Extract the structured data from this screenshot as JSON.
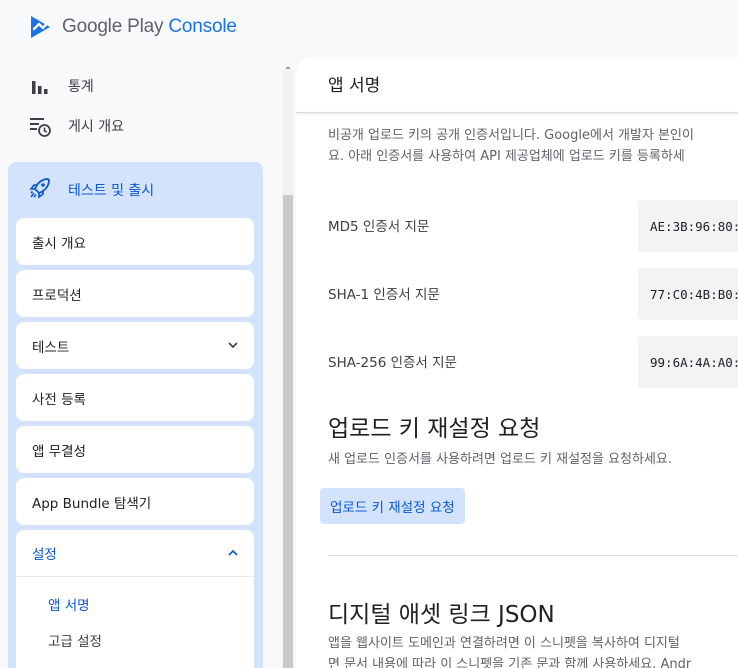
{
  "app": {
    "logo_google_play": "Google Play",
    "logo_console": "Console"
  },
  "nav": {
    "stats": "통계",
    "publishing_overview": "게시 개요",
    "section_label": "테스트 및 출시",
    "items": [
      {
        "label": "출시 개요"
      },
      {
        "label": "프로덕션"
      },
      {
        "label": "테스트"
      },
      {
        "label": "사전 등록"
      },
      {
        "label": "앱 무결성"
      },
      {
        "label": "App Bundle 탐색기"
      }
    ],
    "settings": {
      "label": "설정",
      "sub_items": [
        {
          "label": "앱 서명"
        },
        {
          "label": "고급 설정"
        }
      ]
    }
  },
  "main": {
    "panel_title": "앱 서명",
    "description_line1": "비공개 업로드 키의 공개 인증서입니다. Google에서 개발자 본인이",
    "description_line2": "요. 아래 인증서를 사용하여 API 제공업체에 업로드 키를 등록하세",
    "fingerprints": [
      {
        "label": "MD5 인증서 지문",
        "value": "AE:3B:96:80:"
      },
      {
        "label": "SHA-1 인증서 지문",
        "value": "77:C0:4B:B0:"
      },
      {
        "label": "SHA-256 인증서 지문",
        "value": "99:6A:4A:A0:"
      }
    ],
    "reset": {
      "heading": "업로드 키 재설정 요청",
      "description": "새 업로드 인증서를 사용하려면 업로드 키 재설정을 요청하세요.",
      "button_label": "업로드 키 재설정 요청"
    },
    "dal": {
      "heading": "디지털 애셋 링크 JSON",
      "description_line1": "앱을 웹사이트 도메인과 연결하려면 이 스니펫을 복사하여 디지털",
      "description_line2": "면 문서 내용에 따라 이 스니펫을 기존 문과 함께 사용하세요. Andr"
    }
  },
  "colors": {
    "accent": "#0b57d0",
    "section_bg": "#d3e3fd",
    "logo_blue": "#1a73e8"
  },
  "icons": {
    "logo": "google-play-console-logo",
    "stats": "bar-chart-icon",
    "publishing_overview": "list-clock-icon",
    "release": "rocket-icon",
    "expand": "chevron-down-icon",
    "collapse": "chevron-up-icon"
  }
}
